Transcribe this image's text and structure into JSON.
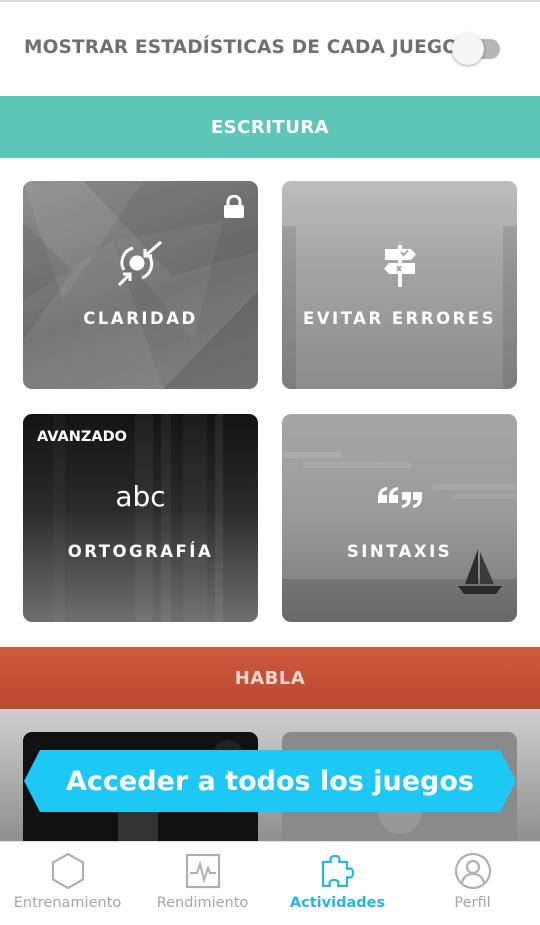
{
  "settings": {
    "show_stats_label": "MOSTRAR ESTADÍSTICAS DE CADA JUEGO",
    "show_stats_enabled": false
  },
  "sections": {
    "escritura": {
      "title": "ESCRITURA",
      "color": "#5fc6ba",
      "games": [
        {
          "name": "CLARIDAD",
          "icon": "focus-arrows-icon",
          "locked": true
        },
        {
          "name": "EVITAR ERRORES",
          "icon": "signpost-icon",
          "locked": false
        },
        {
          "name": "ORTOGRAFÍA",
          "icon_text": "abc",
          "badge": "AVANZADO"
        },
        {
          "name": "SINTAXIS",
          "icon": "quotation-marks-icon"
        }
      ]
    },
    "habla": {
      "title": "HABLA",
      "color": "#c8533a"
    }
  },
  "cta": {
    "label": "Acceder a todos los juegos",
    "color": "#1ec8f4"
  },
  "nav": {
    "items": [
      {
        "label": "Entrenamiento",
        "icon": "hexagon-icon",
        "active": false
      },
      {
        "label": "Rendimiento",
        "icon": "pulse-chart-icon",
        "active": false
      },
      {
        "label": "Actividades",
        "icon": "puzzle-icon",
        "active": true
      },
      {
        "label": "Perfil",
        "icon": "user-icon",
        "active": false
      }
    ],
    "active_color": "#27b5e6"
  }
}
